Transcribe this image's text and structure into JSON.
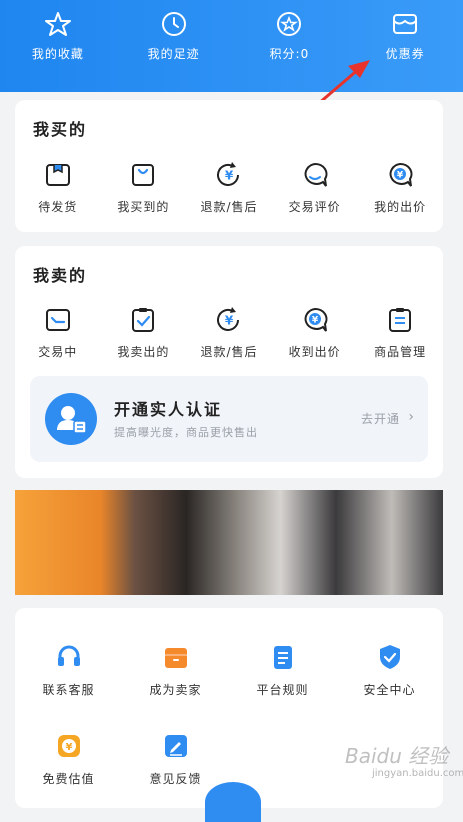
{
  "header": {
    "items": [
      {
        "label": "我的收藏",
        "icon": "star-icon"
      },
      {
        "label": "我的足迹",
        "icon": "clock-icon"
      },
      {
        "label": "积分:0",
        "icon": "points-star-icon"
      },
      {
        "label": "优惠券",
        "icon": "coupon-icon"
      }
    ]
  },
  "buy": {
    "title": "我买的",
    "items": [
      {
        "label": "待发货",
        "icon": "box-icon"
      },
      {
        "label": "我买到的",
        "icon": "shopping-bag-icon"
      },
      {
        "label": "退款/售后",
        "icon": "refund-icon"
      },
      {
        "label": "交易评价",
        "icon": "comment-icon"
      },
      {
        "label": "我的出价",
        "icon": "bid-icon"
      }
    ]
  },
  "sell": {
    "title": "我卖的",
    "items": [
      {
        "label": "交易中",
        "icon": "wallet-icon"
      },
      {
        "label": "我卖出的",
        "icon": "clipboard-check-icon"
      },
      {
        "label": "退款/售后",
        "icon": "refund-icon"
      },
      {
        "label": "收到出价",
        "icon": "bid-icon"
      },
      {
        "label": "商品管理",
        "icon": "product-manage-icon"
      }
    ],
    "verify": {
      "title": "开通实人认证",
      "subtitle": "提高曝光度，商品更快售出",
      "action": "去开通"
    }
  },
  "tools": {
    "items": [
      {
        "label": "联系客服",
        "icon": "headset-icon"
      },
      {
        "label": "成为卖家",
        "icon": "shop-icon"
      },
      {
        "label": "平台规则",
        "icon": "document-icon"
      },
      {
        "label": "安全中心",
        "icon": "shield-icon"
      },
      {
        "label": "免费估值",
        "icon": "yen-coin-icon"
      },
      {
        "label": "意见反馈",
        "icon": "edit-icon"
      }
    ]
  },
  "watermark": {
    "text": "Baidu 经验",
    "sub": "jingyan.baidu.com"
  },
  "colors": {
    "accent": "#1f86f0",
    "icon_dark": "#222222",
    "orange": "#f58a2c",
    "blue": "#2f8cf1"
  }
}
